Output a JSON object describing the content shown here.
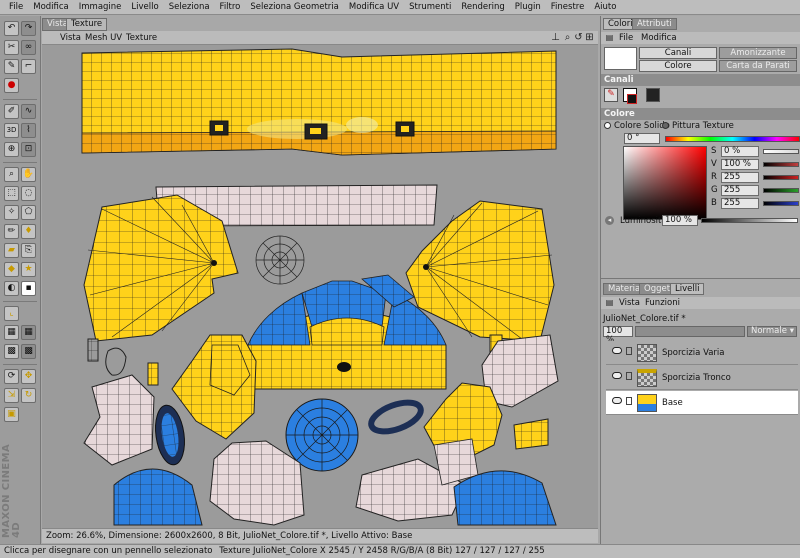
{
  "menubar": {
    "items": [
      "File",
      "Modifica",
      "Immagine",
      "Livello",
      "Seleziona",
      "Filtro",
      "Seleziona Geometria",
      "Modifica UV",
      "Strumenti",
      "Rendering",
      "Plugin",
      "Finestre",
      "Aiuto"
    ]
  },
  "viewport": {
    "tabs": [
      "Vista",
      "Texture"
    ],
    "menu": [
      "Vista",
      "Mesh UV",
      "Texture"
    ],
    "nav_icons": [
      "download-icon",
      "zoom-icon",
      "rotate-icon",
      "expand-icon"
    ],
    "status": "Zoom: 26.6%, Dimensione: 2600x2600, 8 Bit, JulioNet_Colore.tif *, Livello Attivo: Base"
  },
  "logo": "MAXON CINEMA 4D",
  "status_bar": {
    "text": "Clicca per disegnare con un pennello selezionato",
    "info": "Texture JulioNet_Colore  X 2545 / Y 2458 R/G/B/A (8 Bit) 127 / 127 / 127 / 255"
  },
  "right_panel": {
    "top_tabs": [
      "Colori",
      "Attributi"
    ],
    "top_menu": [
      "File",
      "Modifica"
    ],
    "buttons": [
      {
        "label": "Canali",
        "selected": true
      },
      {
        "label": "Amonizzante",
        "selected": false
      },
      {
        "label": "Colore",
        "selected": true
      },
      {
        "label": "Carta da Parati",
        "selected": false
      }
    ],
    "canali_header": "Canali",
    "colore_header": "Colore",
    "mode_options": [
      "Colore Solido",
      "Pittura Texture"
    ],
    "hue_value": "0 °",
    "sliders": [
      {
        "label": "S",
        "value": "0 %",
        "bar": "#d6d6d6"
      },
      {
        "label": "V",
        "value": "100 %",
        "bar": "#c13f3f"
      },
      {
        "label": "R",
        "value": "255",
        "bar": "#cc2020"
      },
      {
        "label": "G",
        "value": "255",
        "bar": "#2aa02a"
      },
      {
        "label": "B",
        "value": "255",
        "bar": "#2a3fcc"
      }
    ],
    "luminosity_label": "Luminosità",
    "luminosity_value": "100 %",
    "bottom_tabs": [
      "Materiali",
      "Oggetti",
      "Livelli"
    ],
    "bottom_menu": [
      "Vista",
      "Funzioni"
    ],
    "file_name": "JulioNet_Colore.tif *",
    "opacity": "100 %",
    "blend_mode": "Normale",
    "layers": [
      {
        "name": "Sporcizia Varia",
        "selected": false
      },
      {
        "name": "Sporcizia Tronco",
        "selected": false
      },
      {
        "name": "Base",
        "selected": true
      }
    ]
  },
  "colors": {
    "uv_yellow": "#ffd21a",
    "uv_blue": "#2b7fe0",
    "uv_pink": "#e7d8da",
    "canvas_bg": "#9b9b9b",
    "accent_dark": "#1d2f55"
  },
  "tools": [
    "brush-icon",
    "eraser-icon",
    "select-icon",
    "lasso-icon",
    "fill-icon",
    "eyedropper-icon",
    "clone-icon",
    "gradient-icon",
    "move-icon",
    "zoom-icon",
    "color-swatch-icon"
  ]
}
